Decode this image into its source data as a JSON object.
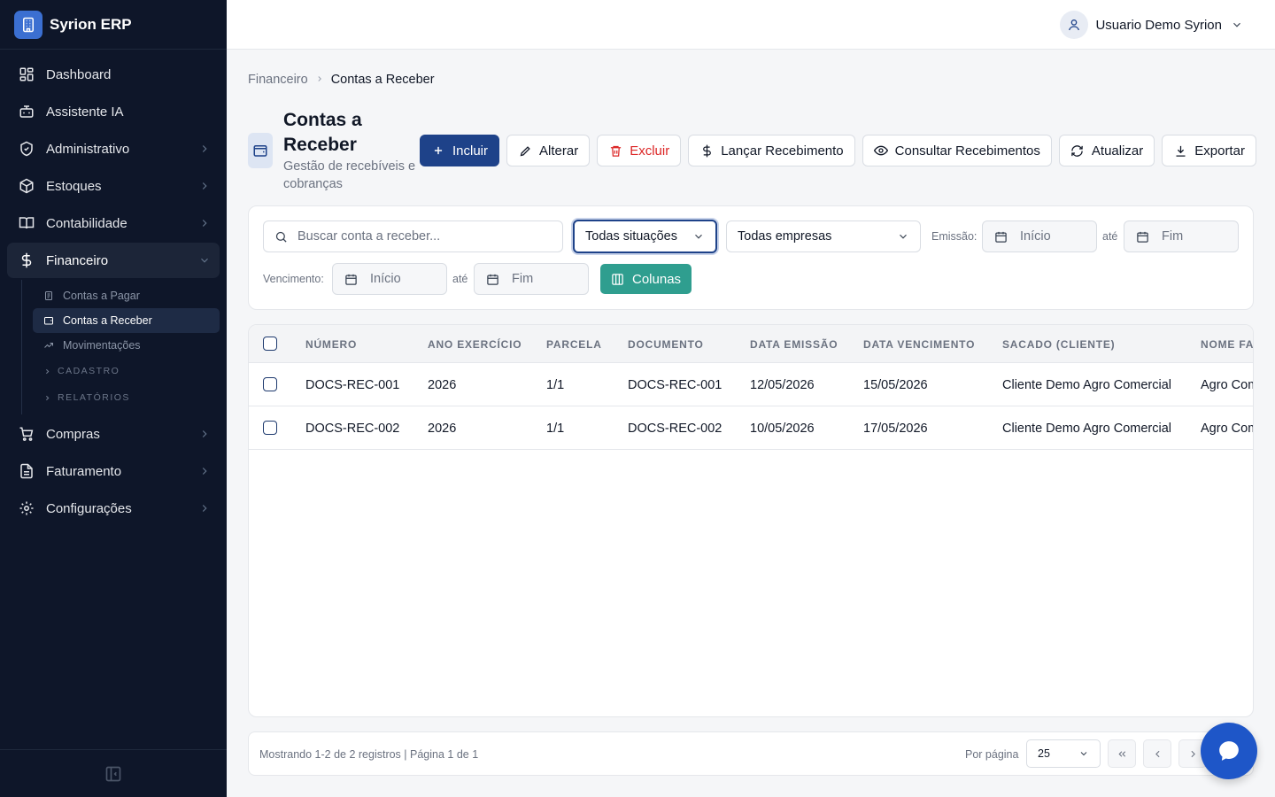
{
  "app": {
    "name": "Syrion ERP"
  },
  "user": {
    "name": "Usuario Demo Syrion"
  },
  "sidebar": {
    "items": [
      {
        "label": "Dashboard",
        "icon": "layout-dashboard-icon"
      },
      {
        "label": "Assistente IA",
        "icon": "bot-icon"
      },
      {
        "label": "Administrativo",
        "icon": "shield-icon"
      },
      {
        "label": "Estoques",
        "icon": "package-icon"
      },
      {
        "label": "Contabilidade",
        "icon": "book-open-icon"
      },
      {
        "label": "Financeiro",
        "icon": "dollar-sign-icon"
      },
      {
        "label": "Compras",
        "icon": "shopping-cart-icon"
      },
      {
        "label": "Faturamento",
        "icon": "file-text-icon"
      },
      {
        "label": "Configurações",
        "icon": "gear-icon"
      }
    ],
    "financeiro_sub": {
      "items": [
        "Contas a Pagar",
        "Contas a Receber",
        "Movimentações"
      ],
      "sections": [
        "CADASTRO",
        "RELATÓRIOS"
      ]
    }
  },
  "breadcrumb": {
    "parent": "Financeiro",
    "current": "Contas a Receber"
  },
  "page": {
    "title": "Contas a Receber",
    "subtitle": "Gestão de recebíveis e cobranças"
  },
  "actions": {
    "incluir": "Incluir",
    "alterar": "Alterar",
    "excluir": "Excluir",
    "lancar": "Lançar Recebimento",
    "consultar": "Consultar Recebimentos",
    "atualizar": "Atualizar",
    "exportar": "Exportar"
  },
  "filters": {
    "search_placeholder": "Buscar conta a receber...",
    "status_value": "Todas situações",
    "company_value": "Todas empresas",
    "emissao_label": "Emissão:",
    "vencimento_label": "Vencimento:",
    "ate": "até",
    "inicio_placeholder": "Início",
    "fim_placeholder": "Fim",
    "colunas": "Colunas"
  },
  "table": {
    "columns": [
      "NÚMERO",
      "ANO EXERCÍCIO",
      "PARCELA",
      "DOCUMENTO",
      "DATA EMISSÃO",
      "DATA VENCIMENTO",
      "SACADO (CLIENTE)",
      "NOME FANTASIA"
    ],
    "rows": [
      [
        "DOCS-REC-001",
        "2026",
        "1/1",
        "DOCS-REC-001",
        "12/05/2026",
        "15/05/2026",
        "Cliente Demo Agro Comercial",
        "Agro Comercial"
      ],
      [
        "DOCS-REC-002",
        "2026",
        "1/1",
        "DOCS-REC-002",
        "10/05/2026",
        "17/05/2026",
        "Cliente Demo Agro Comercial",
        "Agro Comercial"
      ]
    ]
  },
  "pagination": {
    "info": "Mostrando 1-2 de 2 registros | Página 1 de 1",
    "per_page_label": "Por página",
    "per_page_value": "25"
  },
  "colors": {
    "primary": "#1e4289",
    "sidebar": "#0e1629",
    "teal": "#2f9e8f",
    "danger": "#dc2626",
    "fab": "#1e56c8"
  }
}
